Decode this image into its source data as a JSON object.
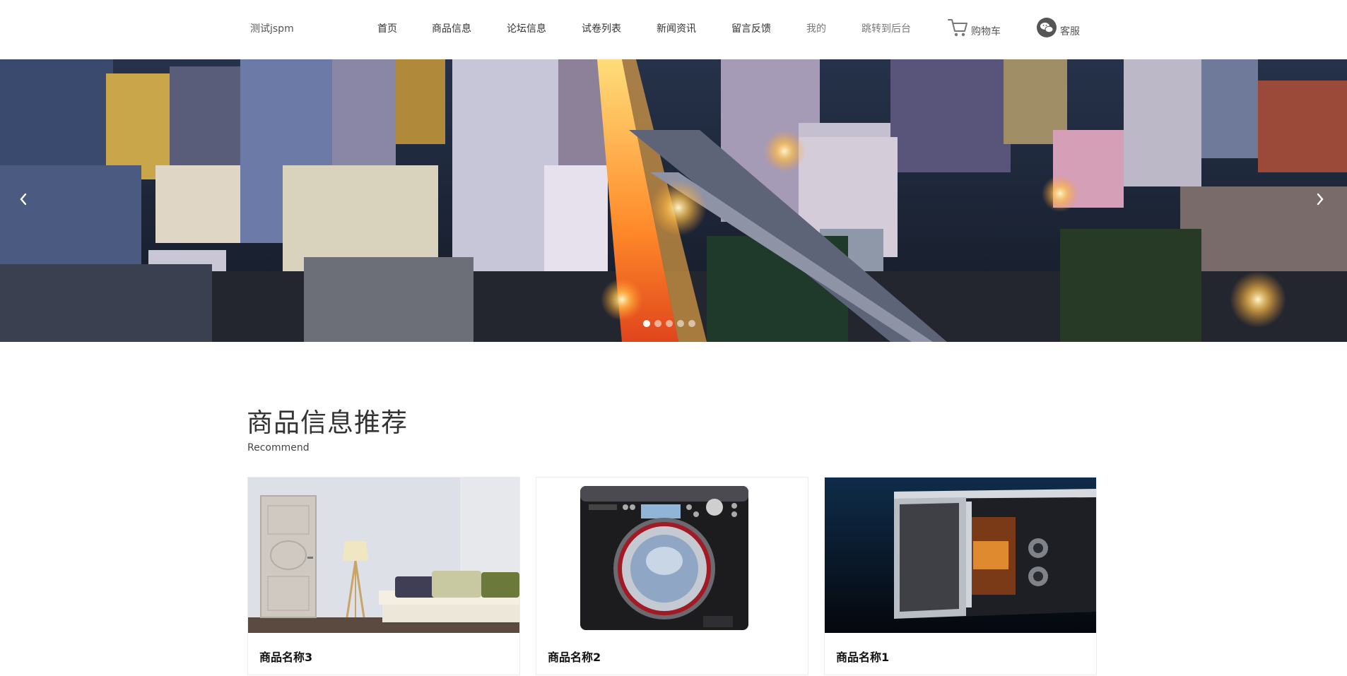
{
  "header": {
    "brand": "测试jspm",
    "nav": [
      {
        "label": "首页"
      },
      {
        "label": "商品信息"
      },
      {
        "label": "论坛信息"
      },
      {
        "label": "试卷列表"
      },
      {
        "label": "新闻资讯"
      },
      {
        "label": "留言反馈"
      },
      {
        "label": "我的"
      },
      {
        "label": "跳转到后台"
      }
    ],
    "cart": {
      "label": "购物车",
      "icon": "cart-icon"
    },
    "service": {
      "label": "客服",
      "icon": "wechat-icon"
    }
  },
  "banner": {
    "slides_count": 5,
    "active_slide": 1,
    "prev_icon": "chevron-left-icon",
    "next_icon": "chevron-right-icon"
  },
  "section": {
    "title": "商品信息推荐",
    "subtitle": "Recommend"
  },
  "products": [
    {
      "name": "商品名称3",
      "image": "living-room-door-sofa"
    },
    {
      "name": "商品名称2",
      "image": "washing-machine"
    },
    {
      "name": "商品名称1",
      "image": "microwave-oven"
    }
  ],
  "colors": {
    "text": "#333333",
    "muted": "#777777",
    "card_border": "#ececec"
  }
}
